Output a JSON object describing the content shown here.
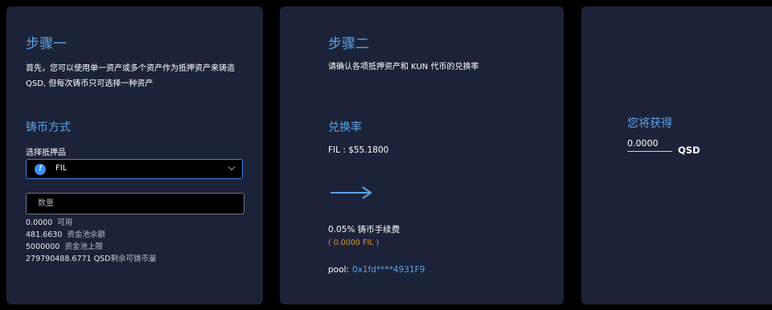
{
  "step1": {
    "title": "步骤一",
    "description": "首先，您可以使用单一资产或多个资产作为抵押资产来铸造 QSD, 但每次铸币只可选择一种资产",
    "mint_method": "铸币方式",
    "collateral_label": "选择抵押品",
    "collateral_value": "FIL",
    "coin_icon": "filecoin-icon",
    "quantity_placeholder": "数量",
    "stats": [
      {
        "value": "0.0000",
        "label": "可用"
      },
      {
        "value": "481.6630",
        "label": "资金池余额"
      },
      {
        "value": "5000000",
        "label": "资金池上限"
      },
      {
        "value": "279790488.6771 QSD",
        "label": "剩余可铸币量"
      }
    ]
  },
  "step2": {
    "title": "步骤二",
    "description": "请确认各项抵押资产和 KUN 代币的兑换率",
    "rate_heading": "兑换率",
    "rate_value": "FIL : $55.1800",
    "fee": "0.05% 铸币手续费",
    "fee_amount": "( 0.0000 FIL )",
    "pool_label": "pool:",
    "pool_address": "0x1fd****4931F9"
  },
  "step3": {
    "heading": "您将获得",
    "amount": "0.0000",
    "unit": "QSD"
  },
  "colors": {
    "card_bg": "#1c2338",
    "accent": "#5aa2e6",
    "fee_orange": "#d6923c"
  }
}
